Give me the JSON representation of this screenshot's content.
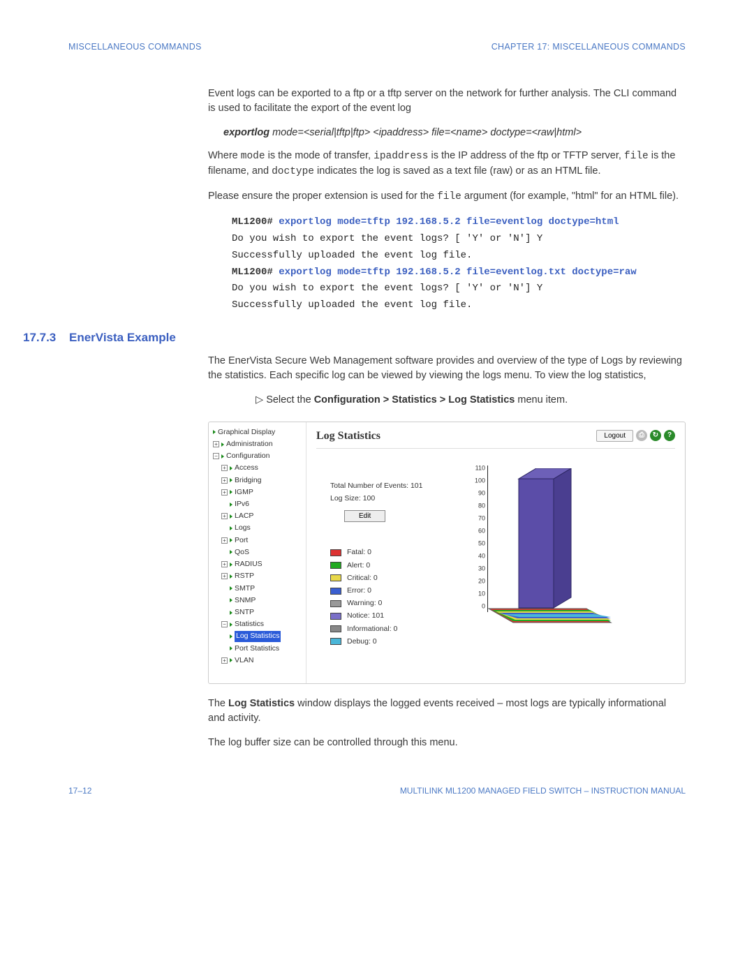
{
  "header": {
    "left": "MISCELLANEOUS COMMANDS",
    "right": "CHAPTER 17:  MISCELLANEOUS COMMANDS"
  },
  "p1": "Event logs can be exported to a ftp or a tftp server on the network for further analysis. The CLI command is used to facilitate the export of the event log",
  "syntax": {
    "cmd": "exportlog",
    "rest": " mode=<serial|tftp|ftp> <ipaddress> file=<name> doctype=<raw|html>"
  },
  "p2a": "Where ",
  "p2b": " is the mode of transfer, ",
  "p2c": " is the IP address of the ftp or TFTP server, ",
  "p2d": " is the filename, and ",
  "p2e": " indicates the log is saved as a text file (raw) or as an HTML file.",
  "mode": "mode",
  "ipaddress": "ipaddress",
  "file": "file",
  "doctype": "doctype",
  "p3a": "Please ensure the proper extension is used for the ",
  "p3b": " argument (for example, \"html\" for an HTML file).",
  "cli": {
    "prompt": "ML1200#",
    "cmd1": " exportlog mode=tftp 192.168.5.2 file=eventlog doctype=html",
    "out1": "Do you wish to export the event logs? [ 'Y' or 'N'] Y",
    "out2": "Successfully uploaded the event log file.",
    "cmd2": " exportlog mode=tftp 192.168.5.2 file=eventlog.txt doctype=raw",
    "out3": "Do you wish to export the event logs? [ 'Y' or 'N'] Y",
    "out4": "Successfully uploaded the event log file."
  },
  "section": {
    "num": "17.7.3",
    "title": "EnerVista Example"
  },
  "p4": "The EnerVista Secure Web Management software provides and overview of the type of Logs by reviewing the statistics. Each specific log can be viewed by viewing the logs menu. To view the log statistics,",
  "step1a": "Select the ",
  "step1b": "Configuration > Statistics > Log Statistics",
  "step1c": " menu item.",
  "ev": {
    "tree": {
      "graphical": "Graphical Display",
      "admin": "Administration",
      "config": "Configuration",
      "access": "Access",
      "bridging": "Bridging",
      "igmp": "IGMP",
      "ipv6": "IPv6",
      "lacp": "LACP",
      "logs": "Logs",
      "port": "Port",
      "qos": "QoS",
      "radius": "RADIUS",
      "rstp": "RSTP",
      "smtp": "SMTP",
      "snmp": "SNMP",
      "sntp": "SNTP",
      "statistics": "Statistics",
      "logstats": "Log Statistics",
      "portstats": "Port Statistics",
      "vlan": "VLAN"
    },
    "title": "Log Statistics",
    "logout": "Logout",
    "totalEvents": "Total Number of Events: 101",
    "logSize": "Log Size: 100",
    "edit": "Edit",
    "legend": [
      {
        "label": "Fatal: 0",
        "color": "#d33"
      },
      {
        "label": "Alert: 0",
        "color": "#2a2"
      },
      {
        "label": "Critical: 0",
        "color": "#e8d84a"
      },
      {
        "label": "Error: 0",
        "color": "#3a5fd0"
      },
      {
        "label": "Warning: 0",
        "color": "#999"
      },
      {
        "label": "Notice: 101",
        "color": "#7a6fc8"
      },
      {
        "label": "Informational: 0",
        "color": "#888"
      },
      {
        "label": "Debug: 0",
        "color": "#4ab6d8"
      }
    ]
  },
  "chart_data": {
    "type": "bar",
    "categories": [
      "Fatal",
      "Alert",
      "Critical",
      "Error",
      "Warning",
      "Notice",
      "Informational",
      "Debug"
    ],
    "values": [
      0,
      0,
      0,
      0,
      0,
      101,
      0,
      0
    ],
    "ylim": [
      0,
      110
    ],
    "title": "",
    "xlabel": "",
    "ylabel": ""
  },
  "p5a": "The ",
  "p5b": "Log Statistics",
  "p5c": " window displays the logged events received – most logs are typically informational and activity.",
  "p6": "The log buffer size can be controlled through this menu.",
  "footer": {
    "left": "17–12",
    "right": "MULTILINK ML1200 MANAGED FIELD SWITCH – INSTRUCTION MANUAL"
  }
}
